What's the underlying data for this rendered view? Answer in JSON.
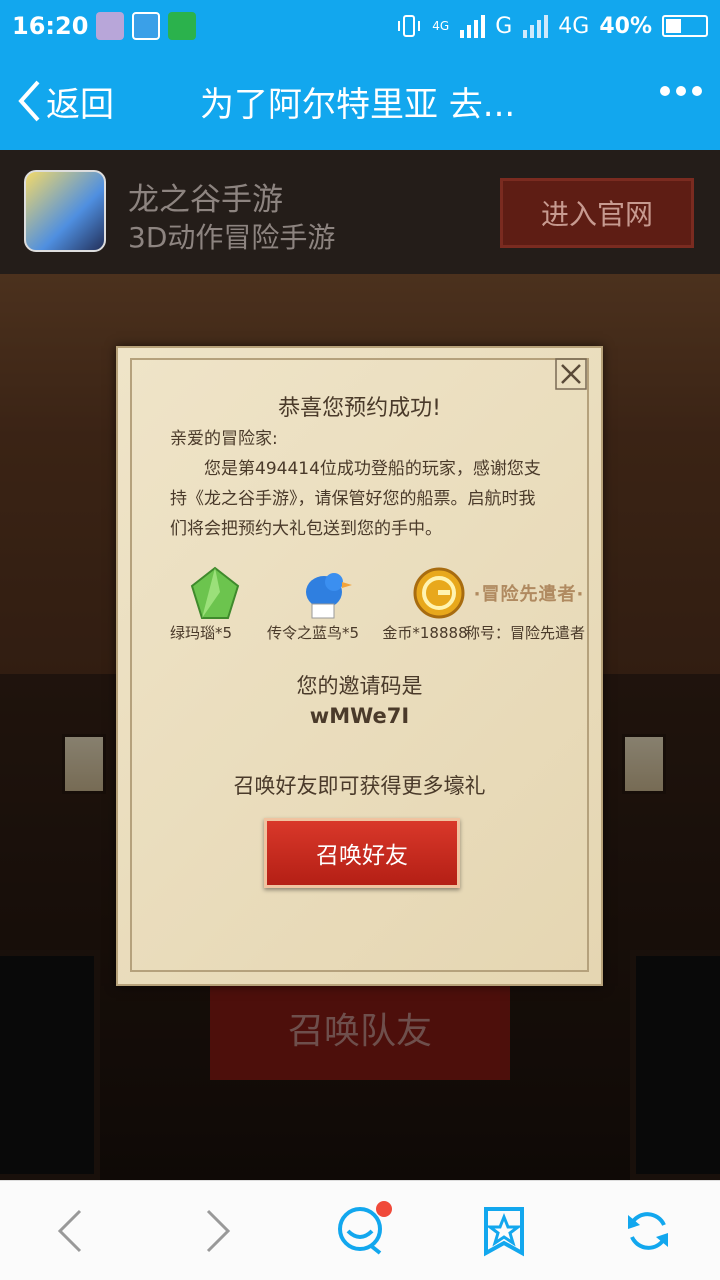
{
  "status_bar": {
    "time": "16:20",
    "network_1": "4G",
    "network_2": "G",
    "network_3": "4G",
    "battery": "40%",
    "battery_level": 0.4
  },
  "nav": {
    "back_label": "返回",
    "title": "为了阿尔特里亚 去..."
  },
  "app_banner": {
    "name": "龙之谷手游",
    "subtitle": "3D动作冒险手游",
    "official_button": "进入官网"
  },
  "background": {
    "summon_team_button": "召唤队友"
  },
  "modal": {
    "title": "恭喜您预约成功!",
    "greeting": "亲爱的冒险家:",
    "body_line1": "您是第494414位成功登船的玩家，感谢您支",
    "body_line2": "持《龙之谷手游》，请保管好您的船票。启航时我",
    "body_line3": "们将会把预约大礼包送到您的手中。",
    "rewards": [
      {
        "label": "绿玛瑙*5",
        "icon": "emerald-icon"
      },
      {
        "label": "传令之蓝鸟*5",
        "icon": "blue-bird-icon"
      },
      {
        "label": "金币*18888",
        "icon": "gold-coin-icon"
      },
      {
        "label": "称号：冒险先遣者",
        "badge": "·冒险先遣者·",
        "icon": "title-badge-icon"
      }
    ],
    "invite_label": "您的邀请码是",
    "invite_code": "wMWe7I",
    "summon_text": "召唤好友即可获得更多壕礼",
    "summon_button": "召唤好友"
  },
  "colors": {
    "accent": "#12a7ee",
    "button_red": "#c62a1e",
    "parchment": "#ebdfc1"
  }
}
